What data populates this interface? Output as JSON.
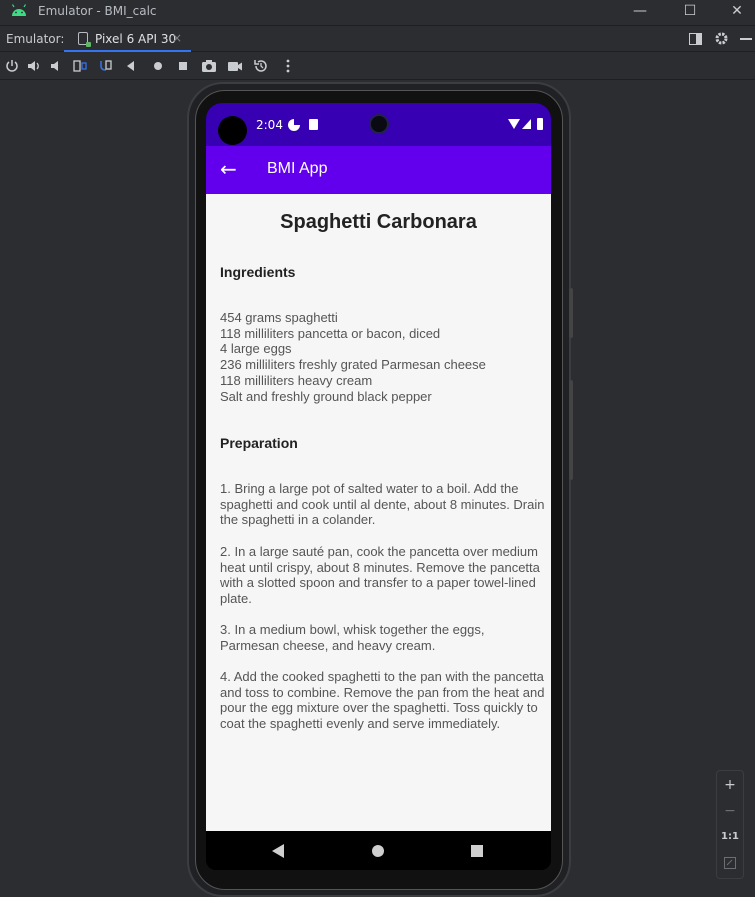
{
  "window": {
    "title": "Emulator - BMI_calc",
    "logo_icon": "android-icon",
    "controls": [
      "minimize-icon",
      "maximize-icon",
      "close-icon"
    ]
  },
  "tabstrip": {
    "label": "Emulator:",
    "tab_label": "Pixel 6 API 30",
    "tab_close": "×",
    "right_icons": [
      "layout-icon",
      "gear-icon",
      "minus-icon"
    ]
  },
  "toolbar": {
    "buttons": [
      "power-icon",
      "volume-up-icon",
      "volume-down-icon",
      "rotate-left-icon",
      "rotate-right-icon",
      "back-icon",
      "home-icon",
      "overview-icon",
      "screenshot-icon",
      "record-icon",
      "snapshot-icon",
      "more-icon"
    ]
  },
  "device": {
    "status": {
      "time": "2:04"
    },
    "appbar": {
      "title": "BMI App",
      "back_glyph": "←"
    },
    "recipe": {
      "title": "Spaghetti Carbonara",
      "ingredients_heading": "Ingredients",
      "ingredients": "454 grams spaghetti\n118 milliliters pancetta or bacon, diced\n4 large eggs\n236 milliliters freshly grated Parmesan cheese\n118 milliliters heavy cream\nSalt and freshly ground black pepper",
      "preparation_heading": "Preparation",
      "steps": [
        "1. Bring a large pot of salted water to a boil. Add the spaghetti and cook until al dente, about 8 minutes. Drain the spaghetti in a colander.",
        "2. In a large sauté pan, cook the pancetta over medium heat until crispy, about 8 minutes. Remove the pancetta with a slotted spoon and transfer to a paper towel-lined plate.",
        "3. In a medium bowl, whisk together the eggs, Parmesan cheese, and heavy cream.",
        "4. Add the cooked spaghetti to the pan with the pancetta and toss to combine. Remove the pan from the heat and pour the egg mixture over the spaghetti. Toss quickly to coat the spaghetti evenly and serve immediately."
      ]
    }
  },
  "zoom": {
    "zoom_in": "+",
    "zoom_out": "−",
    "actual_size": "1:1"
  },
  "colors": {
    "status_bar": "#3700b3",
    "app_bar": "#6200ee",
    "content_bg": "#f6f6f6",
    "ide_bg": "#2b2d30",
    "tab_underline": "#3574f0"
  }
}
